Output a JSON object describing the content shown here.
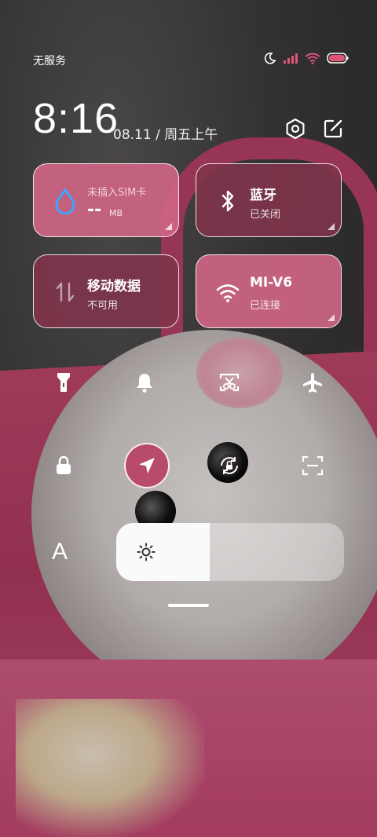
{
  "status_bar": {
    "carrier": "无服务",
    "icons": [
      "moon-icon",
      "signal-icon",
      "wifi-icon",
      "battery-icon"
    ]
  },
  "header": {
    "time": "8:16",
    "date": "08.11 / 周五上午",
    "icons": [
      "settings-icon",
      "edit-icon"
    ]
  },
  "tiles": {
    "data_usage": {
      "title": "未插入SIM卡",
      "value": "--",
      "unit": "MB",
      "icon": "droplet-icon"
    },
    "bluetooth": {
      "title": "蓝牙",
      "status": "已关闭",
      "icon": "bluetooth-icon"
    },
    "mobile_data": {
      "title": "移动数据",
      "status": "不可用",
      "icon": "data-arrows-icon"
    },
    "wifi": {
      "title": "MI-V6",
      "status": "已连接",
      "icon": "wifi-icon"
    }
  },
  "toggles_row1": [
    {
      "name": "flashlight",
      "icon": "flashlight-icon",
      "active": false
    },
    {
      "name": "ringer",
      "icon": "bell-icon",
      "active": false
    },
    {
      "name": "screenshot",
      "icon": "screenshot-scissors-icon",
      "active": false
    },
    {
      "name": "airplane",
      "icon": "airplane-icon",
      "active": false
    }
  ],
  "toggles_row2": [
    {
      "name": "lock-screen",
      "icon": "lock-icon",
      "active": false
    },
    {
      "name": "location",
      "icon": "location-arrow-icon",
      "active": true
    },
    {
      "name": "rotation-lock",
      "icon": "rotation-lock-icon",
      "active": false
    },
    {
      "name": "scan",
      "icon": "scan-icon",
      "active": false
    }
  ],
  "brightness": {
    "level": 0.41,
    "icon": "sun-icon"
  },
  "font_size_label": "A",
  "colors": {
    "tile_active": "#c25a7a",
    "tile_inactive": "#7f3348",
    "accent": "#b84b6c"
  }
}
